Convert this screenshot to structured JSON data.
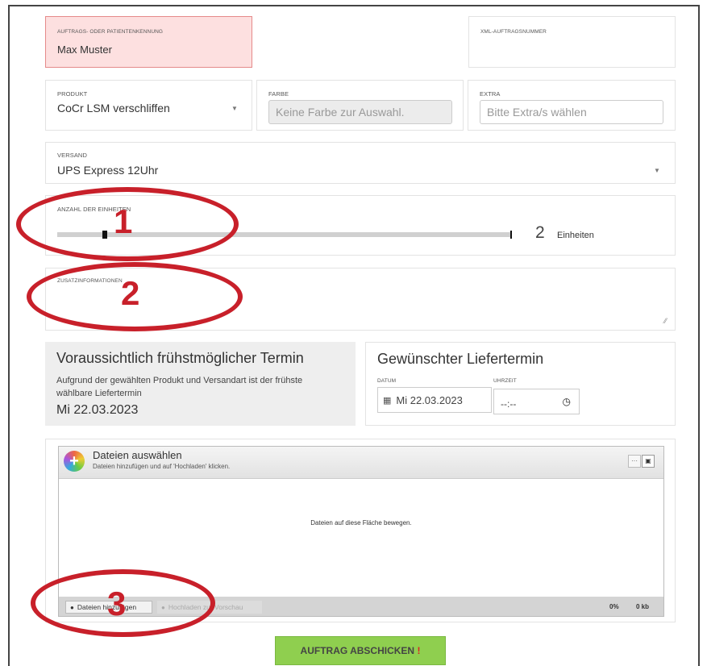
{
  "order": {
    "patient_label": "AUFTRAGS- ODER PATIENTENKENNUNG",
    "patient_value": "Max Muster",
    "xml_label": "XML-AUFTRAGSNUMMER"
  },
  "product": {
    "label": "PRODUKT",
    "value": "CoCr LSM verschliffen"
  },
  "color": {
    "label": "FARBE",
    "placeholder": "Keine Farbe zur Auswahl."
  },
  "extra": {
    "label": "EXTRA",
    "placeholder": "Bitte Extra/s wählen"
  },
  "shipping": {
    "label": "VERSAND",
    "value": "UPS Express 12Uhr"
  },
  "units": {
    "label": "ANZAHL DER EINHEITEN",
    "count": "2",
    "unit_label": "Einheiten",
    "min": 1,
    "max": 16,
    "value": 2
  },
  "additional": {
    "label": "ZUSATZINFORMATIONEN"
  },
  "earliest": {
    "title": "Voraussichtlich frühstmöglicher Termin",
    "text": "Aufgrund der gewählten Produkt und Versandart ist der frühste wählbare Liefertermin",
    "date": "Mi 22.03.2023"
  },
  "desired": {
    "title": "Gewünschter Liefertermin",
    "date_label": "DATUM",
    "date_value": "Mi 22.03.2023",
    "time_label": "UHRZEIT",
    "time_value": "--:--"
  },
  "upload": {
    "title": "Dateien auswählen",
    "subtitle": "Dateien hinzufügen und auf 'Hochladen' klicken.",
    "drop_text": "Dateien auf diese Fläche bewegen.",
    "add_button": "Dateien hinzufügen",
    "upload_button": "Hochladen zur Vorschau",
    "percent": "0%",
    "size": "0 kb"
  },
  "submit": {
    "label": "AUFTRAG ABSCHICKEN",
    "mark": "!"
  },
  "annotations": [
    "1",
    "2",
    "3"
  ],
  "colors": {
    "accent_red": "#c8202a",
    "submit_green": "#8fcf4f",
    "patient_bg": "#fde0e0"
  }
}
